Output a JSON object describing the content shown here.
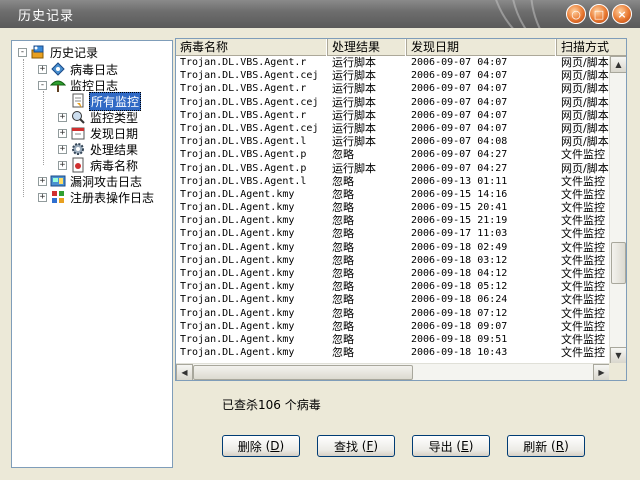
{
  "window": {
    "title": "历史记录",
    "buttons": [
      "○",
      "□",
      "×"
    ]
  },
  "tree": [
    {
      "label": "历史记录",
      "icon": "history-icon",
      "expander": "-",
      "level": 0
    },
    {
      "label": "病毒日志",
      "icon": "virus-log-icon",
      "expander": "+",
      "level": 1
    },
    {
      "label": "监控日志",
      "icon": "monitor-log-icon",
      "expander": "-",
      "level": 1
    },
    {
      "label": "所有监控",
      "icon": "all-monitor-icon",
      "expander": "",
      "level": 2,
      "selected": true
    },
    {
      "label": "监控类型",
      "icon": "monitor-type-icon",
      "expander": "+",
      "level": 2
    },
    {
      "label": "发现日期",
      "icon": "calendar-icon",
      "expander": "+",
      "level": 2
    },
    {
      "label": "处理结果",
      "icon": "gear-icon",
      "expander": "+",
      "level": 2
    },
    {
      "label": "病毒名称",
      "icon": "virus-name-icon",
      "expander": "+",
      "level": 2
    },
    {
      "label": "漏洞攻击日志",
      "icon": "exploit-log-icon",
      "expander": "+",
      "level": 1
    },
    {
      "label": "注册表操作日志",
      "icon": "registry-log-icon",
      "expander": "+",
      "level": 1
    }
  ],
  "table": {
    "columns": [
      "病毒名称",
      "处理结果",
      "发现日期",
      "扫描方式"
    ],
    "rows": [
      [
        "Trojan.DL.VBS.Agent.r",
        "运行脚本",
        "2006-09-07 04:07",
        "网页/脚本"
      ],
      [
        "Trojan.DL.VBS.Agent.cej",
        "运行脚本",
        "2006-09-07 04:07",
        "网页/脚本"
      ],
      [
        "Trojan.DL.VBS.Agent.r",
        "运行脚本",
        "2006-09-07 04:07",
        "网页/脚本"
      ],
      [
        "Trojan.DL.VBS.Agent.cej",
        "运行脚本",
        "2006-09-07 04:07",
        "网页/脚本"
      ],
      [
        "Trojan.DL.VBS.Agent.r",
        "运行脚本",
        "2006-09-07 04:07",
        "网页/脚本"
      ],
      [
        "Trojan.DL.VBS.Agent.cej",
        "运行脚本",
        "2006-09-07 04:07",
        "网页/脚本"
      ],
      [
        "Trojan.DL.VBS.Agent.l",
        "运行脚本",
        "2006-09-07 04:08",
        "网页/脚本"
      ],
      [
        "Trojan.DL.VBS.Agent.p",
        "忽略",
        "2006-09-07 04:27",
        "文件监控"
      ],
      [
        "Trojan.DL.VBS.Agent.p",
        "运行脚本",
        "2006-09-07 04:27",
        "网页/脚本"
      ],
      [
        "Trojan.DL.VBS.Agent.l",
        "忽略",
        "2006-09-13 01:11",
        "文件监控"
      ],
      [
        "Trojan.DL.Agent.kmy",
        "忽略",
        "2006-09-15 14:16",
        "文件监控"
      ],
      [
        "Trojan.DL.Agent.kmy",
        "忽略",
        "2006-09-15 20:41",
        "文件监控"
      ],
      [
        "Trojan.DL.Agent.kmy",
        "忽略",
        "2006-09-15 21:19",
        "文件监控"
      ],
      [
        "Trojan.DL.Agent.kmy",
        "忽略",
        "2006-09-17 11:03",
        "文件监控"
      ],
      [
        "Trojan.DL.Agent.kmy",
        "忽略",
        "2006-09-18 02:49",
        "文件监控"
      ],
      [
        "Trojan.DL.Agent.kmy",
        "忽略",
        "2006-09-18 03:12",
        "文件监控"
      ],
      [
        "Trojan.DL.Agent.kmy",
        "忽略",
        "2006-09-18 04:12",
        "文件监控"
      ],
      [
        "Trojan.DL.Agent.kmy",
        "忽略",
        "2006-09-18 05:12",
        "文件监控"
      ],
      [
        "Trojan.DL.Agent.kmy",
        "忽略",
        "2006-09-18 06:24",
        "文件监控"
      ],
      [
        "Trojan.DL.Agent.kmy",
        "忽略",
        "2006-09-18 07:12",
        "文件监控"
      ],
      [
        "Trojan.DL.Agent.kmy",
        "忽略",
        "2006-09-18 09:07",
        "文件监控"
      ],
      [
        "Trojan.DL.Agent.kmy",
        "忽略",
        "2006-09-18 09:51",
        "文件监控"
      ],
      [
        "Trojan.DL.Agent.kmy",
        "忽略",
        "2006-09-18 10:43",
        "文件监控"
      ]
    ]
  },
  "status": {
    "text": "已查杀106 个病毒"
  },
  "buttons": {
    "delete": {
      "label": "删除",
      "key": "D"
    },
    "find": {
      "label": "查找",
      "key": "F"
    },
    "export": {
      "label": "导出",
      "key": "E"
    },
    "refresh": {
      "label": "刷新",
      "key": "R"
    }
  },
  "colors": {
    "selection": "#316ac5",
    "window_bg": "#ece9d8",
    "titlebar": "#6e6e6e"
  }
}
